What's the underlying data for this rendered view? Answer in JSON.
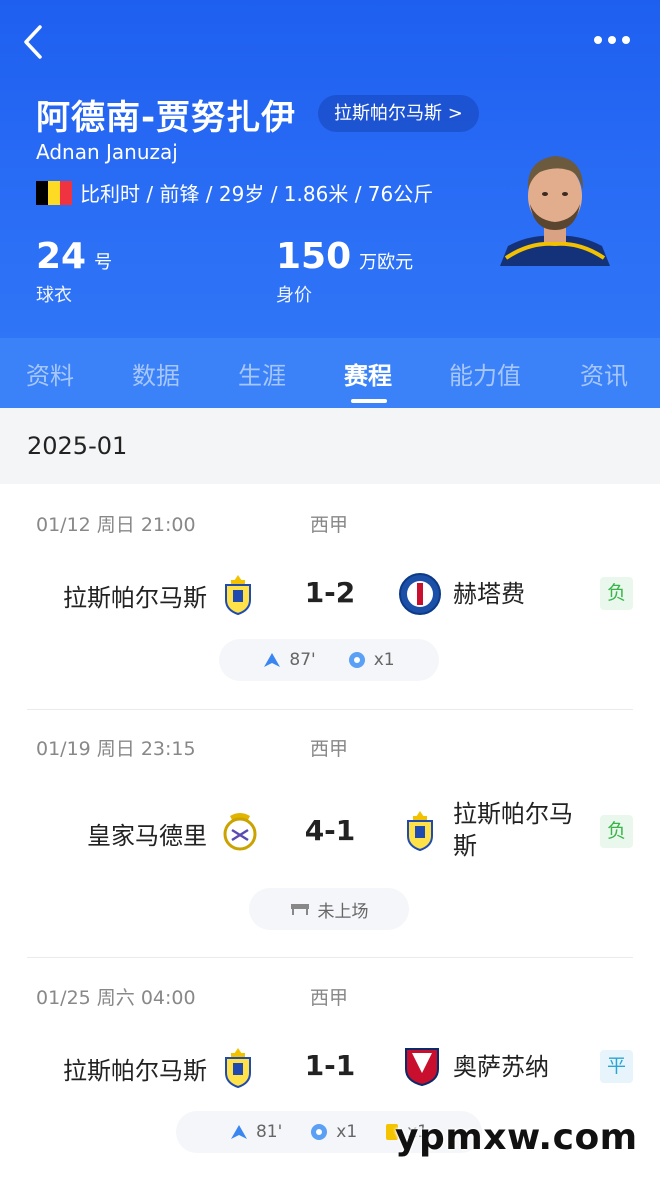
{
  "header": {
    "player_name": "阿德南-贾努扎伊",
    "team_link": "拉斯帕尔马斯 >",
    "player_name_en": "Adnan Januzaj",
    "info": "比利时 / 前锋 / 29岁 / 1.86米 / 76公斤",
    "shirt_number": "24",
    "shirt_unit": "号",
    "shirt_label": "球衣",
    "market_value": "150",
    "market_value_unit": "万欧元",
    "market_value_label": "身价",
    "flag_colors": [
      "#000000",
      "#fdda24",
      "#ef3340"
    ],
    "accent_color": "#2a6df5"
  },
  "tabs": [
    {
      "label": "资料",
      "active": false
    },
    {
      "label": "数据",
      "active": false
    },
    {
      "label": "生涯",
      "active": false
    },
    {
      "label": "赛程",
      "active": true
    },
    {
      "label": "能力值",
      "active": false
    },
    {
      "label": "资讯",
      "active": false
    }
  ],
  "month": "2025-01",
  "matches": [
    {
      "time": "01/12  周日 21:00",
      "league": "西甲",
      "home": "拉斯帕尔马斯",
      "score": "1-2",
      "away": "赫塔费",
      "result": "负",
      "stats": [
        {
          "icon": "minutes-played-icon",
          "text": "87'"
        },
        {
          "icon": "goal-icon",
          "text": "x1"
        }
      ]
    },
    {
      "time": "01/19  周日 23:15",
      "league": "西甲",
      "home": "皇家马德里",
      "score": "4-1",
      "away": "拉斯帕尔马斯",
      "result": "负",
      "stats": [
        {
          "icon": "bench-icon",
          "text": "未上场"
        }
      ]
    },
    {
      "time": "01/25  周六 04:00",
      "league": "西甲",
      "home": "拉斯帕尔马斯",
      "score": "1-1",
      "away": "奥萨苏纳",
      "result": "平",
      "stats": [
        {
          "icon": "minutes-played-icon",
          "text": "81'"
        },
        {
          "icon": "goal-icon",
          "text": "x1"
        },
        {
          "icon": "yellow-card-icon",
          "text": "x1"
        }
      ]
    }
  ],
  "watermark": "ypmxw.com"
}
